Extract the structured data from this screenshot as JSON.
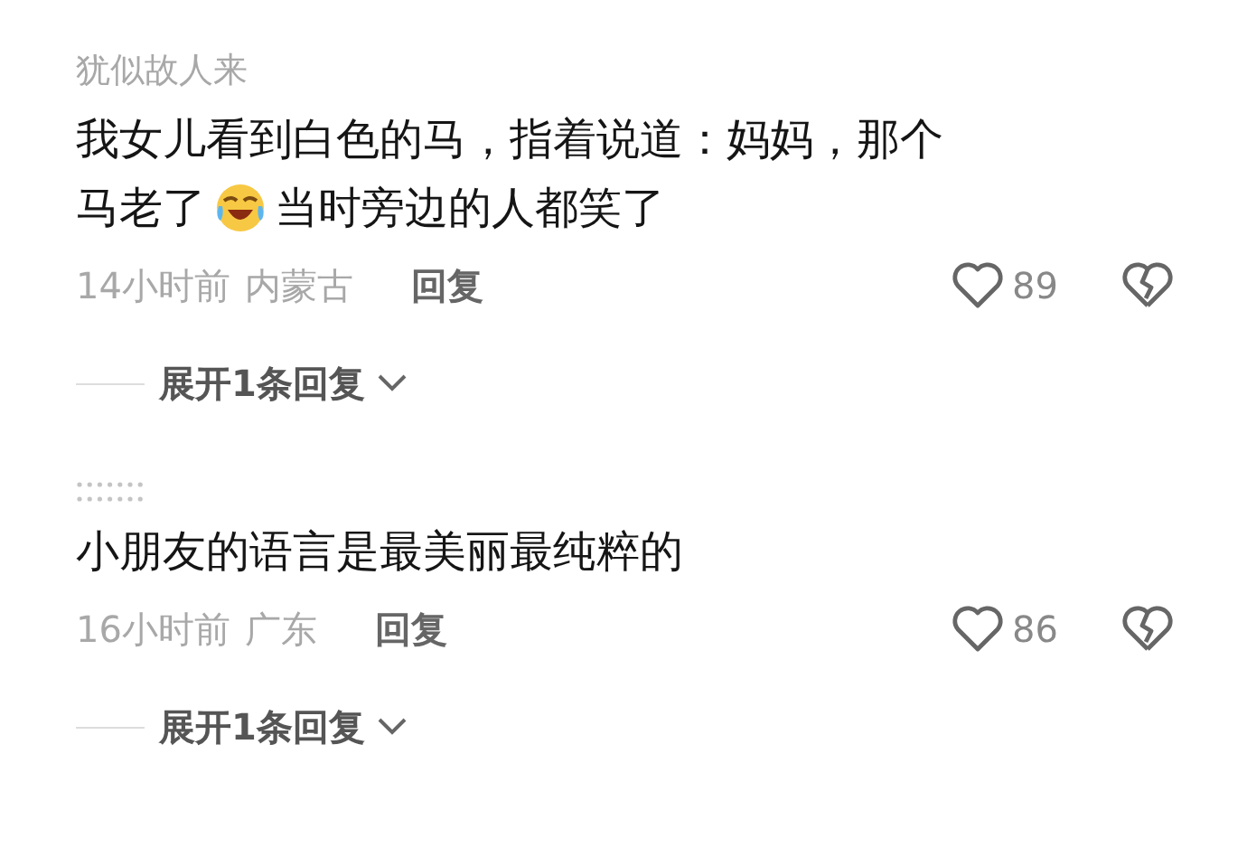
{
  "comments": [
    {
      "author": {
        "kind": "name",
        "text": "犹似故人来"
      },
      "lines": [
        [
          {
            "kind": "text",
            "text": "我女儿看到白色的马，指着说道：妈妈，那个"
          }
        ],
        [
          {
            "kind": "text",
            "text": "马老了"
          },
          {
            "kind": "emoji"
          },
          {
            "kind": "text",
            "text": "当时旁边的人都笑了"
          }
        ]
      ],
      "time": "14小时前",
      "location": "内蒙古",
      "reply": "回复",
      "likes": "89",
      "expand": "展开1条回复"
    },
    {
      "author": {
        "kind": "masked"
      },
      "lines": [
        [
          {
            "kind": "text",
            "text": "小朋友的语言是最美丽最纯粹的"
          }
        ]
      ],
      "time": "16小时前",
      "location": "广东",
      "reply": "回复",
      "likes": "86",
      "expand": "展开1条回复"
    }
  ]
}
